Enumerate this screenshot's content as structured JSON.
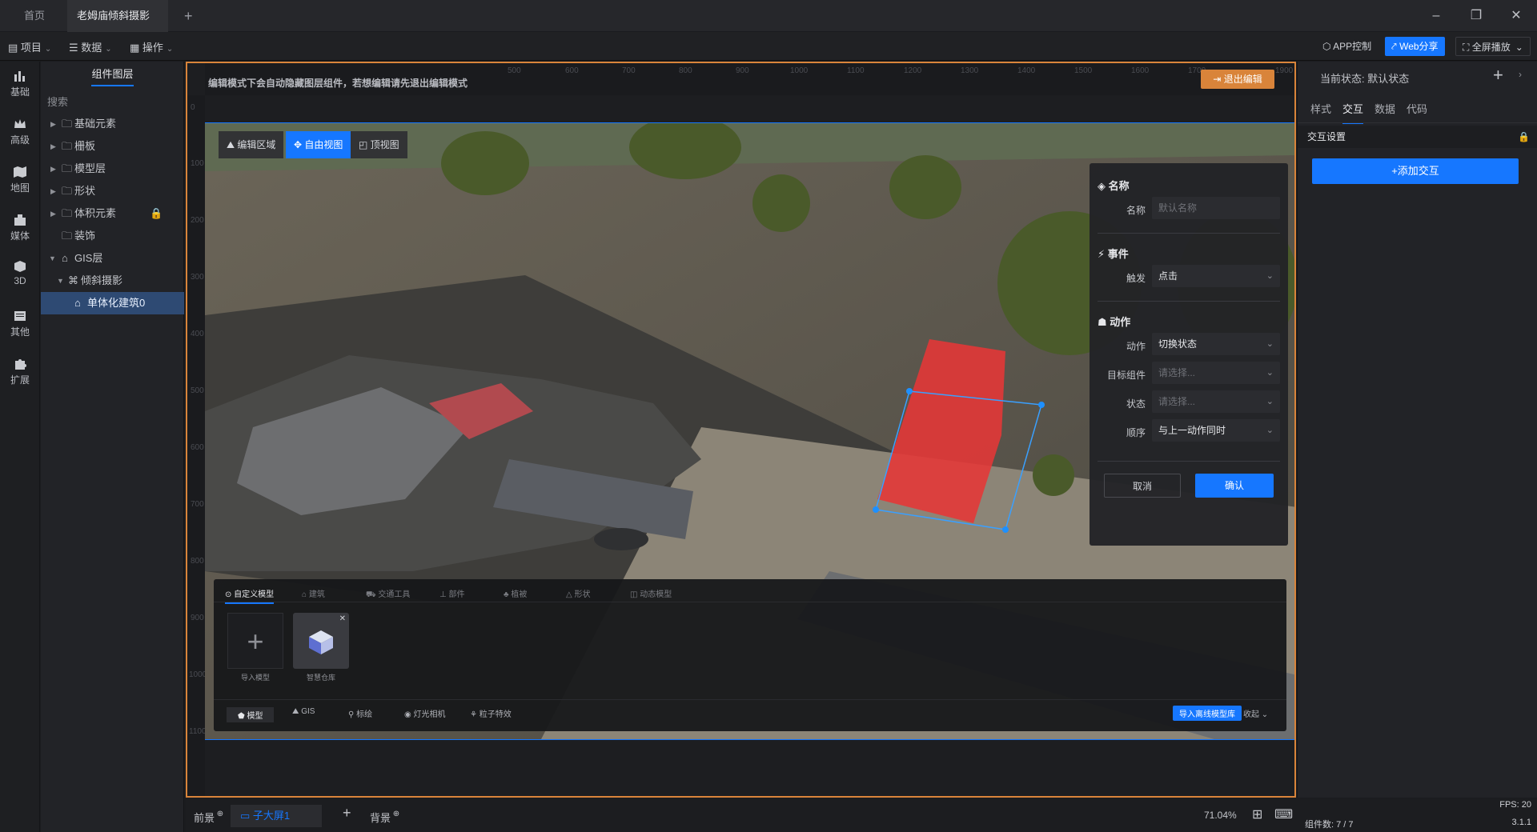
{
  "titlebar": {
    "tabs": [
      {
        "label": "首页"
      },
      {
        "label": "老姆庙倾斜摄影"
      }
    ],
    "new_tab": "+"
  },
  "toolbar": {
    "menus": [
      {
        "label": "项目"
      },
      {
        "label": "数据"
      },
      {
        "label": "操作"
      }
    ],
    "app_control": "APP控制",
    "web_share": "Web分享",
    "fullscreen": "全屏播放"
  },
  "rail": {
    "items": [
      {
        "label": "基础",
        "icon": "bar-chart-icon"
      },
      {
        "label": "高级",
        "icon": "crown-icon"
      },
      {
        "label": "地图",
        "icon": "map-icon"
      },
      {
        "label": "媒体",
        "icon": "media-icon"
      },
      {
        "label": "3D",
        "icon": "cube-icon"
      },
      {
        "label": "其他",
        "icon": "list-icon"
      },
      {
        "label": "扩展",
        "icon": "puzzle-icon"
      }
    ]
  },
  "layers": {
    "title": "组件图层",
    "search_placeholder": "搜索",
    "tree": [
      {
        "label": "基础元素"
      },
      {
        "label": "栅板"
      },
      {
        "label": "模型层"
      },
      {
        "label": "形状"
      },
      {
        "label": "体积元素"
      },
      {
        "label": "装饰"
      },
      {
        "label": "GIS层"
      },
      {
        "label": "倾斜摄影"
      },
      {
        "label": "单体化建筑0"
      }
    ]
  },
  "canvas": {
    "notice": "编辑模式下会自动隐藏图层组件，若想编辑请先退出编辑模式",
    "exit_edit": "退出编辑",
    "ruler_top": [
      "500",
      "600",
      "700",
      "800",
      "900",
      "1000",
      "1100",
      "1200",
      "1300",
      "1400",
      "1500",
      "1600",
      "1700",
      "1900"
    ],
    "ruler_left": [
      "0",
      "100",
      "200",
      "300",
      "400",
      "500",
      "600",
      "700",
      "800",
      "900",
      "1000",
      "1100"
    ],
    "view_buttons": [
      {
        "label": "编辑区域"
      },
      {
        "label": "自由视图"
      },
      {
        "label": "顶视图"
      }
    ]
  },
  "popup": {
    "name_section": "名称",
    "name_label": "名称",
    "name_placeholder": "默认名称",
    "event_section": "事件",
    "trigger_label": "触发",
    "trigger_value": "点击",
    "action_section": "动作",
    "action_label": "动作",
    "action_value": "切换状态",
    "target_label": "目标组件",
    "target_placeholder": "请选择...",
    "state_label": "状态",
    "state_placeholder": "请选择...",
    "order_label": "顺序",
    "order_value": "与上一动作同时",
    "cancel": "取消",
    "confirm": "确认"
  },
  "library": {
    "tabs": [
      "自定义模型",
      "建筑",
      "交通工具",
      "部件",
      "植被",
      "形状",
      "动态模型"
    ],
    "cards": [
      {
        "label": "导入模型"
      },
      {
        "label": "智慧仓库"
      }
    ],
    "bottom_tabs": [
      "模型",
      "GIS",
      "标绘",
      "灯光相机",
      "粒子特效"
    ],
    "import_btn": "导入离线模型库",
    "collapse": "收起"
  },
  "right_panel": {
    "current_state_label": "当前状态:",
    "current_state_value": "默认状态",
    "tabs": [
      "样式",
      "交互",
      "数据",
      "代码"
    ],
    "section": "交互设置",
    "add_btn": "+添加交互"
  },
  "status": {
    "foreground": "前景",
    "screen_tab": "子大屏1",
    "background": "背景",
    "zoom": "71.04%",
    "fps": "FPS: 20",
    "component_count": "组件数: 7 / 7",
    "version": "3.1.1"
  },
  "colors": {
    "accent": "#1677ff",
    "orange": "#d9843a",
    "highlight_red": "#e63737"
  }
}
